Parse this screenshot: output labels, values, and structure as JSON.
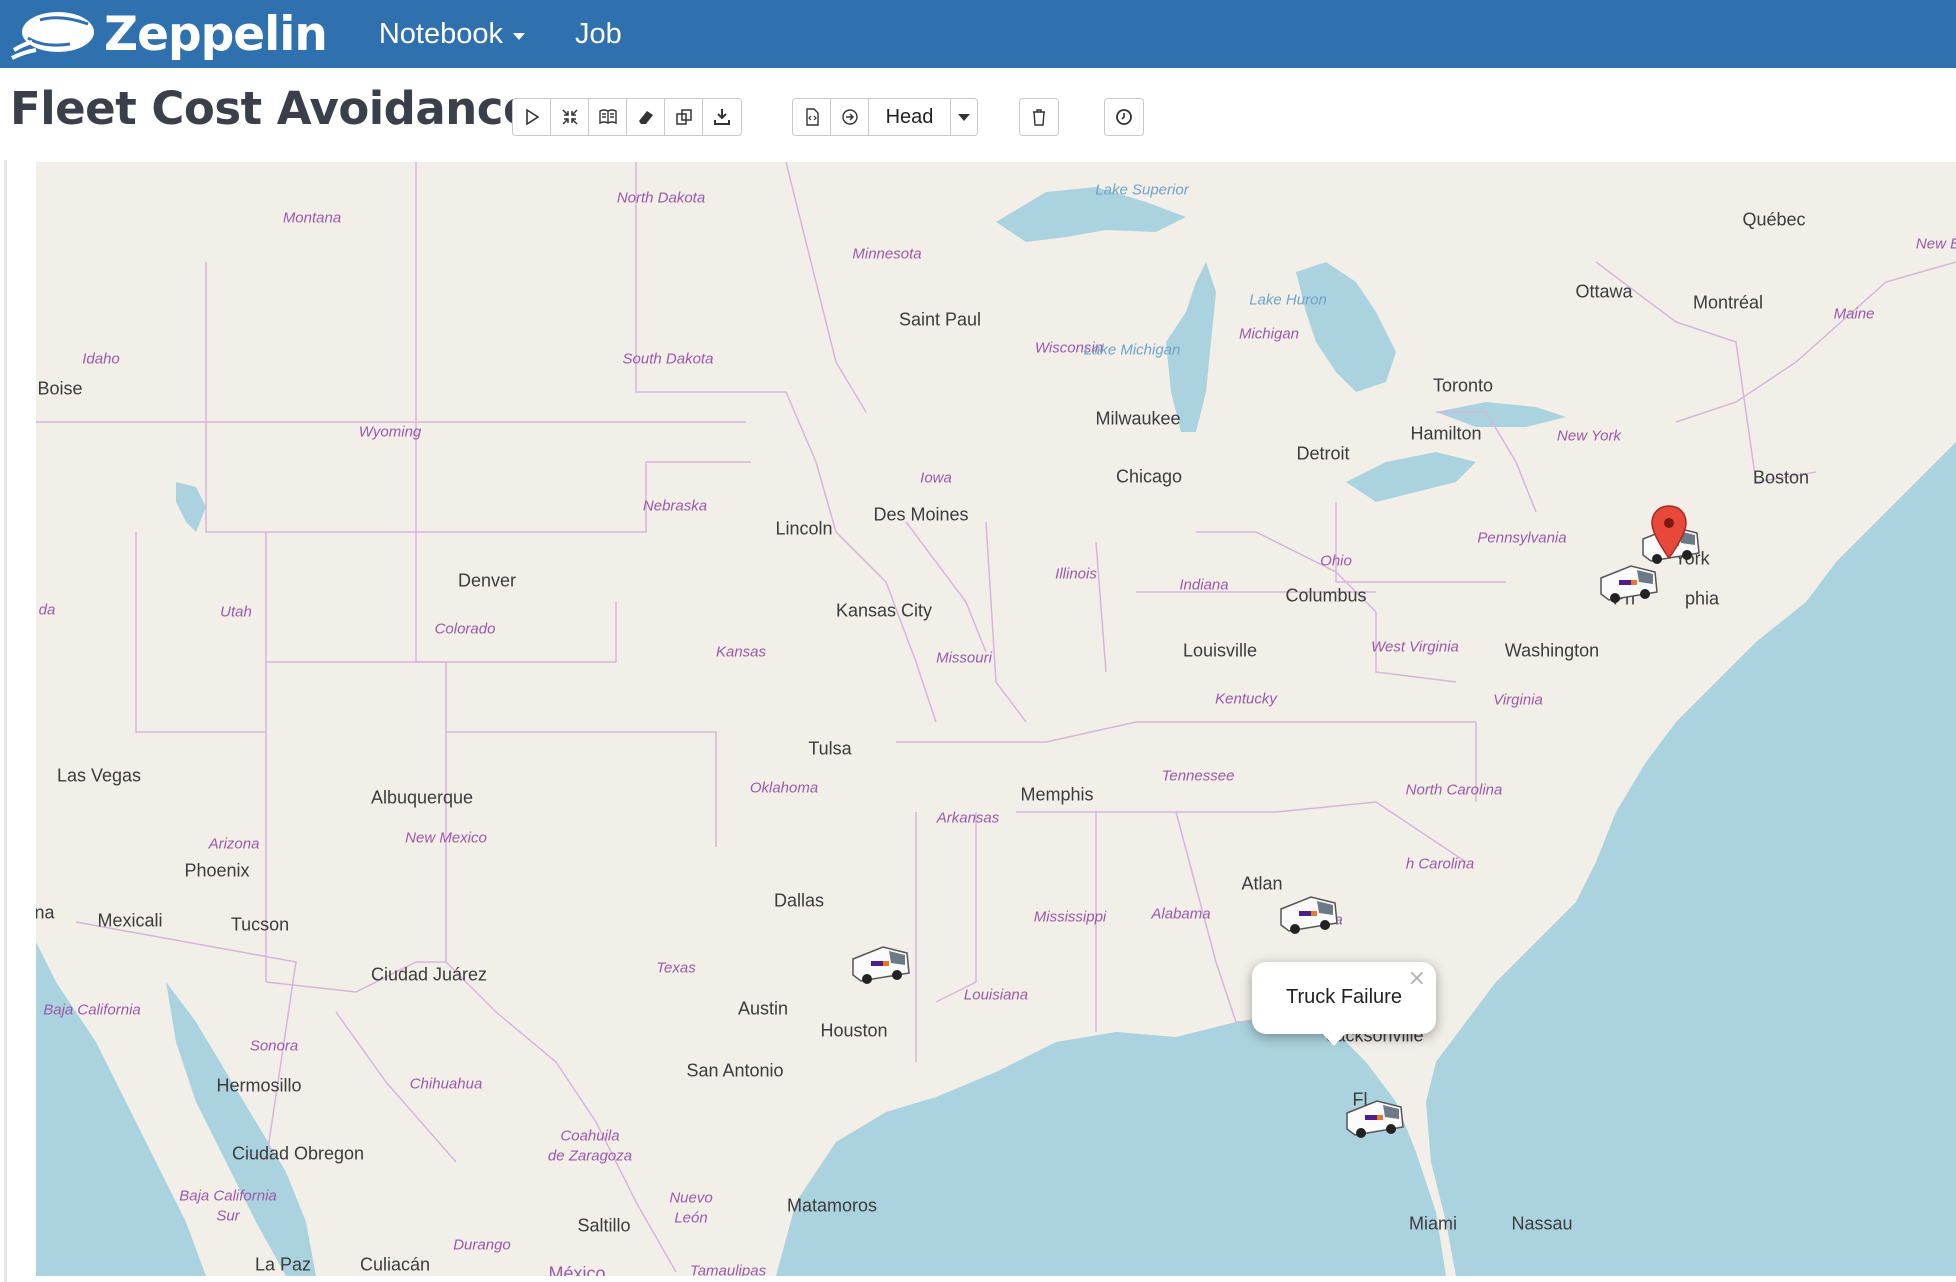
{
  "navbar": {
    "brand": "Zeppelin",
    "notebook_label": "Notebook",
    "job_label": "Job"
  },
  "note": {
    "title": "Fleet Cost Avoidance",
    "revision_label": "Head"
  },
  "toolbar_icons": [
    "run-all-icon",
    "collapse-icon",
    "book-icon",
    "eraser-icon",
    "clone-icon",
    "download-icon",
    "version-control-icon",
    "revision-icon",
    "trash-icon",
    "clock-icon"
  ],
  "map": {
    "states": [
      {
        "id": "montana",
        "label": "Montana"
      },
      {
        "id": "north-dakota",
        "label": "North Dakota"
      },
      {
        "id": "minnesota",
        "label": "Minnesota"
      },
      {
        "id": "idaho",
        "label": "Idaho"
      },
      {
        "id": "south-dakota",
        "label": "South Dakota"
      },
      {
        "id": "wyoming",
        "label": "Wyoming"
      },
      {
        "id": "wisconsin",
        "label": "Wisconsin"
      },
      {
        "id": "michigan",
        "label": "Michigan"
      },
      {
        "id": "iowa",
        "label": "Iowa"
      },
      {
        "id": "nebraska",
        "label": "Nebraska"
      },
      {
        "id": "utah",
        "label": "Utah"
      },
      {
        "id": "nevada",
        "label": "da"
      },
      {
        "id": "colorado",
        "label": "Colorado"
      },
      {
        "id": "kansas",
        "label": "Kansas"
      },
      {
        "id": "missouri",
        "label": "Missouri"
      },
      {
        "id": "illinois",
        "label": "Illinois"
      },
      {
        "id": "indiana",
        "label": "Indiana"
      },
      {
        "id": "ohio",
        "label": "Ohio"
      },
      {
        "id": "pennsylvania",
        "label": "Pennsylvania"
      },
      {
        "id": "new-york",
        "label": "New York"
      },
      {
        "id": "west-virginia",
        "label": "West Virginia"
      },
      {
        "id": "virginia",
        "label": "Virginia"
      },
      {
        "id": "kentucky",
        "label": "Kentucky"
      },
      {
        "id": "tennessee",
        "label": "Tennessee"
      },
      {
        "id": "north-carolina",
        "label": "North Carolina"
      },
      {
        "id": "south-carolina",
        "label": "h Carolina"
      },
      {
        "id": "oklahoma",
        "label": "Oklahoma"
      },
      {
        "id": "arkansas",
        "label": "Arkansas"
      },
      {
        "id": "arizona",
        "label": "Arizona"
      },
      {
        "id": "new-mexico",
        "label": "New Mexico"
      },
      {
        "id": "mississippi",
        "label": "Mississippi"
      },
      {
        "id": "alabama",
        "label": "Alabama"
      },
      {
        "id": "georgia",
        "label": "Georgia"
      },
      {
        "id": "texas",
        "label": "Texas"
      },
      {
        "id": "louisiana",
        "label": "Louisiana"
      },
      {
        "id": "maine",
        "label": "Maine"
      },
      {
        "id": "new-brunswick",
        "label": "New B"
      },
      {
        "id": "baja-california",
        "label": "Baja California"
      },
      {
        "id": "sonora",
        "label": "Sonora"
      },
      {
        "id": "chihuahua",
        "label": "Chihuahua"
      },
      {
        "id": "coahuila-1",
        "label": "Coahuila"
      },
      {
        "id": "coahuila-2",
        "label": "de Zaragoza"
      },
      {
        "id": "nuevo-leon-1",
        "label": "Nuevo"
      },
      {
        "id": "nuevo-leon-2",
        "label": "León"
      },
      {
        "id": "baja-sur-1",
        "label": "Baja California"
      },
      {
        "id": "baja-sur-2",
        "label": "Sur"
      },
      {
        "id": "durango",
        "label": "Durango"
      },
      {
        "id": "tamaulipas",
        "label": "Tamaulipas"
      }
    ],
    "cities": [
      {
        "id": "saint-paul",
        "label": "Saint Paul"
      },
      {
        "id": "boise",
        "label": "Boise"
      },
      {
        "id": "milwaukee",
        "label": "Milwaukee"
      },
      {
        "id": "chicago",
        "label": "Chicago"
      },
      {
        "id": "detroit",
        "label": "Detroit"
      },
      {
        "id": "toronto",
        "label": "Toronto"
      },
      {
        "id": "hamilton",
        "label": "Hamilton"
      },
      {
        "id": "ottawa",
        "label": "Ottawa"
      },
      {
        "id": "montreal",
        "label": "Montréal"
      },
      {
        "id": "quebec",
        "label": "Québec"
      },
      {
        "id": "boston",
        "label": "Boston"
      },
      {
        "id": "new-york-city",
        "label": "York"
      },
      {
        "id": "philadelphia",
        "label": "Ph"
      },
      {
        "id": "philadelphia-end",
        "label": "phia"
      },
      {
        "id": "washington",
        "label": "Washington"
      },
      {
        "id": "des-moines",
        "label": "Des Moines"
      },
      {
        "id": "lincoln",
        "label": "Lincoln"
      },
      {
        "id": "denver",
        "label": "Denver"
      },
      {
        "id": "kansas-city",
        "label": "Kansas City"
      },
      {
        "id": "columbus",
        "label": "Columbus"
      },
      {
        "id": "louisville",
        "label": "Louisville"
      },
      {
        "id": "tulsa",
        "label": "Tulsa"
      },
      {
        "id": "memphis",
        "label": "Memphis"
      },
      {
        "id": "las-vegas",
        "label": "Las Vegas"
      },
      {
        "id": "albuquerque",
        "label": "Albuquerque"
      },
      {
        "id": "phoenix",
        "label": "Phoenix"
      },
      {
        "id": "tucson",
        "label": "Tucson"
      },
      {
        "id": "mexicali",
        "label": "Mexicali"
      },
      {
        "id": "tijuana",
        "label": "ına"
      },
      {
        "id": "dallas",
        "label": "Dallas"
      },
      {
        "id": "atlanta",
        "label": "Atlan"
      },
      {
        "id": "ciudad-juarez",
        "label": "Ciudad Juárez"
      },
      {
        "id": "austin",
        "label": "Austin"
      },
      {
        "id": "houston",
        "label": "Houston"
      },
      {
        "id": "san-antonio",
        "label": "San Antonio"
      },
      {
        "id": "jacksonville",
        "label": "Jacksonville"
      },
      {
        "id": "hermosillo",
        "label": "Hermosillo"
      },
      {
        "id": "ciudad-obregon",
        "label": "Ciudad Obregon"
      },
      {
        "id": "saltillo",
        "label": "Saltillo"
      },
      {
        "id": "matamoros",
        "label": "Matamoros"
      },
      {
        "id": "miami",
        "label": "Miami"
      },
      {
        "id": "nassau",
        "label": "Nassau"
      },
      {
        "id": "la-paz",
        "label": "La Paz"
      },
      {
        "id": "culiacan",
        "label": "Culiacán"
      },
      {
        "id": "fl-fragment",
        "label": "Fl"
      }
    ],
    "water": [
      {
        "id": "lake-superior",
        "label": "Lake Superior"
      },
      {
        "id": "lake-huron",
        "label": "Lake Huron"
      },
      {
        "id": "lake-michigan",
        "label": "Lake Michigan"
      }
    ],
    "countries": [
      {
        "id": "mexico",
        "label": "México"
      }
    ],
    "markers": [
      {
        "id": "truck-texas",
        "icon": "truck-icon"
      },
      {
        "id": "truck-atlanta",
        "icon": "truck-icon"
      },
      {
        "id": "truck-florida",
        "icon": "truck-icon"
      },
      {
        "id": "truck-philadelphia",
        "icon": "truck-icon"
      },
      {
        "id": "truck-newyork",
        "icon": "truck-icon"
      },
      {
        "id": "pin-newyork",
        "icon": "map-pin-icon"
      }
    ],
    "popup": {
      "text": "Truck Failure",
      "close": "×"
    }
  },
  "colors": {
    "navbar": "#2f71ae",
    "land": "#f2efe9",
    "water": "#aad3df",
    "state_border": "#d7b5dc",
    "pin": "#e8483a"
  }
}
